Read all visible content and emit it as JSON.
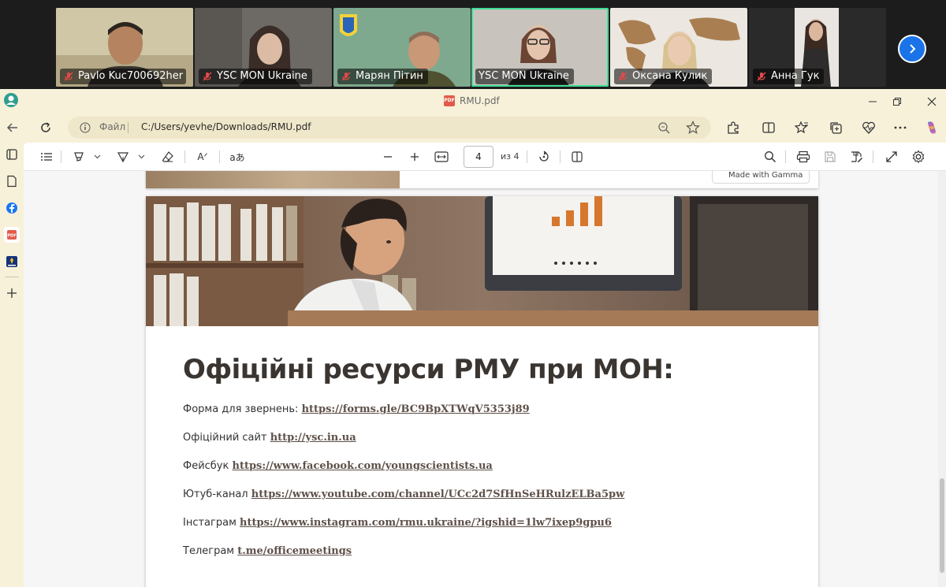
{
  "call": {
    "participants": [
      {
        "name": "Pavlo Kuc700692her",
        "active": false
      },
      {
        "name": "YSC MON Ukraine",
        "active": false
      },
      {
        "name": "Марян Пітин",
        "active": false
      },
      {
        "name": "YSC MON Ukraine",
        "active": true
      },
      {
        "name": "Оксана Кулик",
        "active": false
      },
      {
        "name": "Анна Гук",
        "active": false
      }
    ]
  },
  "browser": {
    "tab_title": "RMU.pdf",
    "pdf_badge": "PDF",
    "address_label": "Файл",
    "address_url": "C:/Users/yevhe/Downloads/RMU.pdf"
  },
  "pdf_toolbar": {
    "read_aloud_label": "Aᐟ",
    "translate_label": "aあ",
    "current_page": "4",
    "page_of": "из 4"
  },
  "document": {
    "made_badge": "Made with Gamma",
    "title": "Офіційні ресурси РМУ при МОН:",
    "resources": [
      {
        "label": "Форма для звернень:",
        "link": "https://forms.gle/BC9BpXTWqV5353j89"
      },
      {
        "label": "Офіційний сайт",
        "link": "http://ysc.in.ua"
      },
      {
        "label": "Фейсбук",
        "link": "https://www.facebook.com/youngscientists.ua"
      },
      {
        "label": "Ютуб-канал",
        "link": "https://www.youtube.com/channel/UCc2d7SfHnSeHRulzELBa5pw"
      },
      {
        "label": "Інстаграм",
        "link": "https://www.instagram.com/rmu.ukraine/?igshid=1lw7ixep9gpu6"
      },
      {
        "label": "Телеграм",
        "link": "t.me/officemeetings"
      }
    ]
  },
  "colors": {
    "accent": "#1a73e8",
    "active_tile": "#3ddc97",
    "browser_bg": "#f7f1da",
    "title_text": "#3a3530",
    "link_text": "#5e5048"
  }
}
